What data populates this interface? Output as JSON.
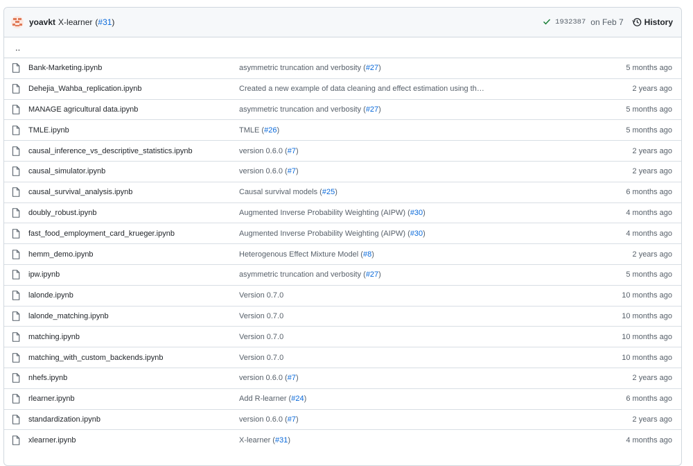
{
  "latest_commit": {
    "author": "yoavkt",
    "message": "X-learner",
    "pr_open": "(",
    "pr": "#31",
    "pr_close": ")",
    "sha": "1932387",
    "date": "on Feb 7",
    "history_label": "History",
    "status_icon": "check-icon",
    "accent": "#0969da",
    "success": "#1a7f37"
  },
  "parent_dir_label": "..",
  "files": [
    {
      "name": "Bank-Marketing.ipynb",
      "msg": "asymmetric truncation and verbosity ",
      "pr": "#27",
      "age": "5 months ago"
    },
    {
      "name": "Dehejia_Wahba_replication.ipynb",
      "msg": "Created a new example of data cleaning and effect estimation using th…",
      "pr": "",
      "age": "2 years ago"
    },
    {
      "name": "MANAGE agricultural data.ipynb",
      "msg": "asymmetric truncation and verbosity ",
      "pr": "#27",
      "age": "5 months ago"
    },
    {
      "name": "TMLE.ipynb",
      "msg": "TMLE ",
      "pr": "#26",
      "age": "5 months ago"
    },
    {
      "name": "causal_inference_vs_descriptive_statistics.ipynb",
      "msg": "version 0.6.0 ",
      "pr": "#7",
      "age": "2 years ago"
    },
    {
      "name": "causal_simulator.ipynb",
      "msg": "version 0.6.0 ",
      "pr": "#7",
      "age": "2 years ago"
    },
    {
      "name": "causal_survival_analysis.ipynb",
      "msg": "Causal survival models ",
      "pr": "#25",
      "age": "6 months ago"
    },
    {
      "name": "doubly_robust.ipynb",
      "msg": "Augmented Inverse Probability Weighting (AIPW) ",
      "pr": "#30",
      "age": "4 months ago"
    },
    {
      "name": "fast_food_employment_card_krueger.ipynb",
      "msg": "Augmented Inverse Probability Weighting (AIPW) ",
      "pr": "#30",
      "age": "4 months ago"
    },
    {
      "name": "hemm_demo.ipynb",
      "msg": "Heterogenous Effect Mixture Model ",
      "pr": "#8",
      "age": "2 years ago"
    },
    {
      "name": "ipw.ipynb",
      "msg": "asymmetric truncation and verbosity ",
      "pr": "#27",
      "age": "5 months ago"
    },
    {
      "name": "lalonde.ipynb",
      "msg": "Version 0.7.0",
      "pr": "",
      "age": "10 months ago"
    },
    {
      "name": "lalonde_matching.ipynb",
      "msg": "Version 0.7.0",
      "pr": "",
      "age": "10 months ago"
    },
    {
      "name": "matching.ipynb",
      "msg": "Version 0.7.0",
      "pr": "",
      "age": "10 months ago"
    },
    {
      "name": "matching_with_custom_backends.ipynb",
      "msg": "Version 0.7.0",
      "pr": "",
      "age": "10 months ago"
    },
    {
      "name": "nhefs.ipynb",
      "msg": "version 0.6.0 ",
      "pr": "#7",
      "age": "2 years ago"
    },
    {
      "name": "rlearner.ipynb",
      "msg": "Add R-learner ",
      "pr": "#24",
      "age": "6 months ago"
    },
    {
      "name": "standardization.ipynb",
      "msg": "version 0.6.0 ",
      "pr": "#7",
      "age": "2 years ago"
    },
    {
      "name": "xlearner.ipynb",
      "msg": "X-learner ",
      "pr": "#31",
      "age": "4 months ago"
    }
  ]
}
